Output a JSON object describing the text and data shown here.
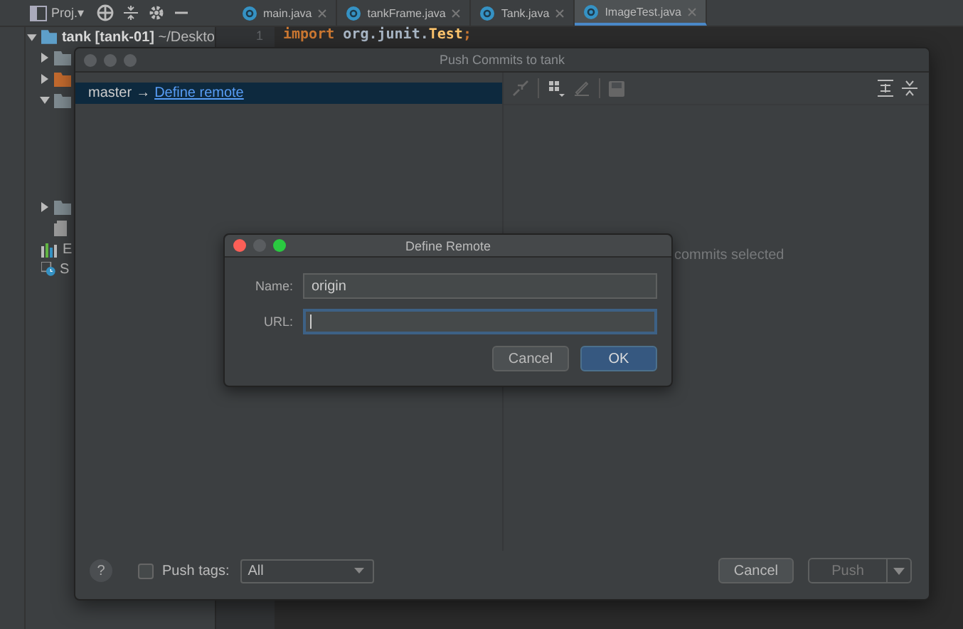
{
  "ide": {
    "project_selector": "Proj.▾",
    "tabs": [
      {
        "label": "main.java",
        "selected": false
      },
      {
        "label": "tankFrame.java",
        "selected": false
      },
      {
        "label": "Tank.java",
        "selected": false
      },
      {
        "label": "ImageTest.java",
        "selected": true
      }
    ],
    "project_tree": [
      {
        "label": "**tank [tank-01]** ~/Deskto",
        "kind": "module",
        "expanded": true,
        "children": [
          {
            "kind": "folder",
            "expanded": false
          },
          {
            "kind": "source-folder",
            "expanded": false
          },
          {
            "kind": "folder",
            "expanded": true
          },
          {
            "kind": "folder",
            "expanded": false
          },
          {
            "kind": "file"
          }
        ]
      },
      {
        "label": "E",
        "kind": "library"
      },
      {
        "label": "S",
        "kind": "scratch"
      }
    ],
    "code": {
      "line_number": "1",
      "tokens": [
        {
          "text": "import ",
          "kind": "keyword"
        },
        {
          "text": "org.junit.",
          "kind": "plain"
        },
        {
          "text": "Test",
          "kind": "class"
        },
        {
          "text": ";",
          "kind": "keyword"
        }
      ]
    }
  },
  "push_dialog": {
    "title": "Push Commits to tank",
    "branch_row": {
      "branch": "master",
      "arrow": "→",
      "link": "Define remote",
      "selected": true
    },
    "details_message": "commits selected",
    "help": "?",
    "push_tags": {
      "label": "Push tags:",
      "checked": false,
      "value": "All"
    },
    "buttons": [
      {
        "label": "Cancel",
        "kind": "normal",
        "disabled": false
      },
      {
        "label": "Push",
        "kind": "split",
        "disabled": true
      }
    ]
  },
  "define_remote_dialog": {
    "title": "Define Remote",
    "fields": [
      {
        "label": "Name:",
        "value": "origin",
        "focused": false
      },
      {
        "label": "URL:",
        "focused": true
      }
    ],
    "buttons": [
      {
        "label": "Cancel",
        "kind": "normal"
      },
      {
        "label": "OK",
        "kind": "primary"
      }
    ]
  }
}
